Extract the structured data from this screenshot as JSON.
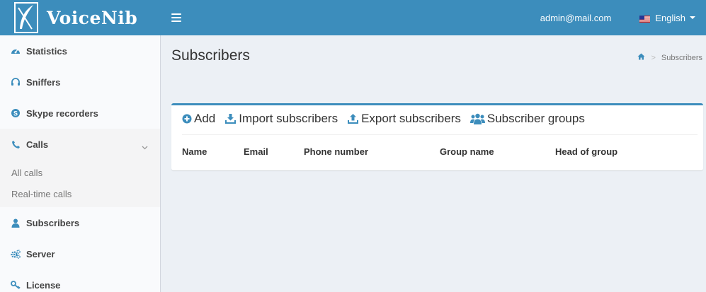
{
  "header": {
    "brand": "VoiceNib",
    "user_email": "admin@mail.com",
    "language": "English"
  },
  "colors": {
    "primary": "#3c8dbc",
    "sidebar_bg": "#f9fafc",
    "content_bg": "#ecf0f5"
  },
  "sidebar": {
    "items": [
      {
        "label": "Statistics",
        "icon": "dashboard-icon"
      },
      {
        "label": "Sniffers",
        "icon": "headphones-icon"
      },
      {
        "label": "Skype recorders",
        "icon": "skype-icon"
      },
      {
        "label": "Calls",
        "icon": "phone-icon",
        "expanded": true
      },
      {
        "label": "Subscribers",
        "icon": "user-icon"
      },
      {
        "label": "Server",
        "icon": "gears-icon"
      },
      {
        "label": "License",
        "icon": "key-icon"
      }
    ],
    "calls_submenu": [
      {
        "label": "All calls"
      },
      {
        "label": "Real-time calls"
      }
    ]
  },
  "page": {
    "title": "Subscribers",
    "breadcrumb_current": "Subscribers"
  },
  "toolbar": {
    "add": "Add",
    "import": "Import subscribers",
    "export": "Export subscribers",
    "groups": "Subscriber groups"
  },
  "table": {
    "columns": [
      "Name",
      "Email",
      "Phone number",
      "Group name",
      "Head of group"
    ]
  }
}
